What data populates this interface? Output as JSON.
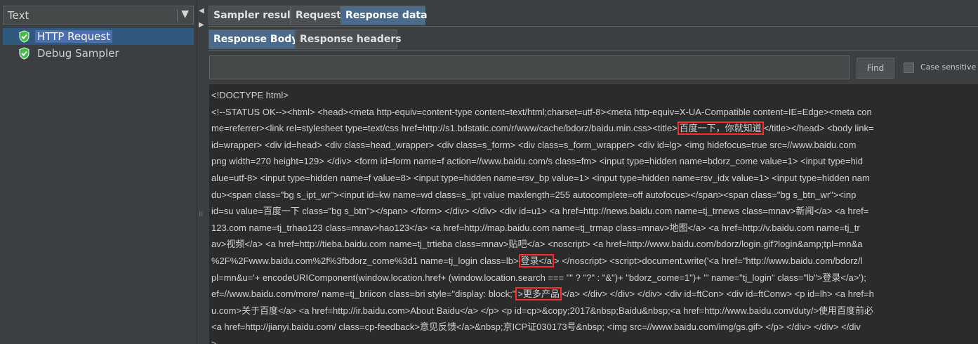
{
  "left_panel": {
    "renderer": "Text",
    "tree": [
      {
        "label": "HTTP Request",
        "selected": true
      },
      {
        "label": "Debug Sampler",
        "selected": false
      }
    ]
  },
  "tabs": {
    "level1": [
      "Sampler result",
      "Request",
      "Response data"
    ],
    "level2": [
      "Response Body",
      "Response headers"
    ]
  },
  "search": {
    "value": "",
    "find_label": "Find",
    "case_label": "Case sensitive"
  },
  "response_body": {
    "lines": [
      [
        "<!DOCTYPE html>"
      ],
      [
        "<!--STATUS OK--><html> <head><meta http-equiv=content-type content=text/html;charset=utf-8><meta http-equiv=X-UA-Compatible content=IE=Edge><meta con"
      ],
      [
        "me=referrer><link rel=stylesheet type=text/css href=http://s1.bdstatic.com/r/www/cache/bdorz/baidu.min.css><title>",
        {
          "box": "百度一下，你就知道"
        },
        "</title></head> <body link="
      ],
      [
        "id=wrapper> <div id=head> <div class=head_wrapper> <div class=s_form> <div class=s_form_wrapper> <div id=lg> <img hidefocus=true src=//www.baidu.com"
      ],
      [
        "png width=270 height=129> </div> <form id=form name=f action=//www.baidu.com/s class=fm> <input type=hidden name=bdorz_come value=1> <input type=hid"
      ],
      [
        "alue=utf-8> <input type=hidden name=f value=8> <input type=hidden name=rsv_bp value=1> <input type=hidden name=rsv_idx value=1> <input type=hidden nam"
      ],
      [
        "du><span class=\"bg s_ipt_wr\"><input id=kw name=wd class=s_ipt value maxlength=255 autocomplete=off autofocus></span><span class=\"bg s_btn_wr\"><inp"
      ],
      [
        "id=su value=百度一下 class=\"bg s_btn\"></span> </form> </div> </div> <div id=u1> <a href=http://news.baidu.com name=tj_trnews class=mnav>新闻</a> <a href="
      ],
      [
        "123.com name=tj_trhao123 class=mnav>hao123</a> <a href=http://map.baidu.com name=tj_trmap class=mnav>地图</a> <a href=http://v.baidu.com name=tj_tr"
      ],
      [
        "av>视频</a> <a href=http://tieba.baidu.com name=tj_trtieba class=mnav>贴吧</a> <noscript> <a href=http://www.baidu.com/bdorz/login.gif?login&amp;tpl=mn&a"
      ],
      [
        "%2F%2Fwww.baidu.com%2f%3fbdorz_come%3d1 name=tj_login class=lb>",
        {
          "box": "登录</a"
        },
        "> </noscript> <script>document.write('<a href=\"http://www.baidu.com/bdorz/l"
      ],
      [
        "pl=mn&u='+ encodeURIComponent(window.location.href+ (window.location.search === \"\" ? \"?\" : \"&\")+ \"bdorz_come=1\")+ '\" name=\"tj_login\" class=\"lb\">登录</a>');"
      ],
      [
        "ef=//www.baidu.com/more/ name=tj_briicon class=bri style=\"display: block;\"",
        {
          "box": ">更多产品"
        },
        "</a> </div> </div> </div> <div id=ftCon> <div id=ftConw> <p id=lh> <a href=h"
      ],
      [
        "u.com>关于百度</a> <a href=http://ir.baidu.com>About Baidu</a> </p> <p id=cp>&copy;2017&nbsp;Baidu&nbsp;<a href=http://www.baidu.com/duty/>使用百度前必"
      ],
      [
        "<a href=http://jianyi.baidu.com/ class=cp-feedback>意见反馈</a>&nbsp;京ICP证030173号&nbsp; <img src=//www.baidu.com/img/gs.gif> </p> </div> </div> </div"
      ],
      [
        ">"
      ]
    ]
  }
}
